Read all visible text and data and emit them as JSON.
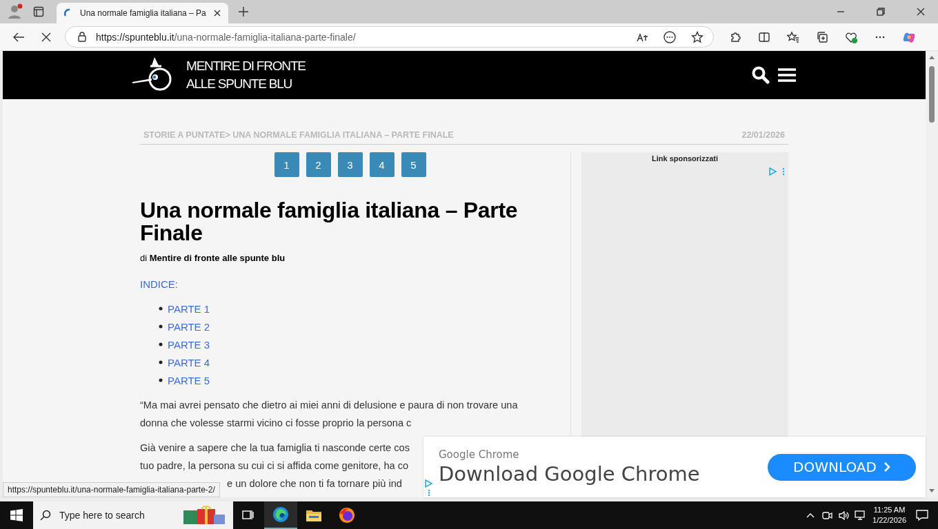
{
  "browser": {
    "tabs": [
      {
        "title": "Una normale famiglia italiana – Pa",
        "selected": true
      }
    ],
    "url_host": "https://spunteblu.it",
    "url_path": "/una-normale-famiglia-italiana-parte-finale/"
  },
  "site": {
    "logo_line1": "MENTIRE DI FRONTE",
    "logo_line2": "ALLE SPUNTE BLU"
  },
  "breadcrumb": "STORIE A PUNTATE> UNA NORMALE FAMIGLIA ITALIANA – PARTE FINALE",
  "date": "22/01/2026",
  "pages": [
    "1",
    "2",
    "3",
    "4",
    "5"
  ],
  "article": {
    "title": "Una normale famiglia italiana – Parte Finale",
    "byline": "di **Mentire di fronte alle spunte blu**",
    "index_label": "INDICE:",
    "index_items": [
      "PARTE 1",
      "PARTE 2",
      "PARTE 3",
      "PARTE 4",
      "PARTE 5"
    ],
    "paragraphs": [
      {
        "lines": [
          "“Ma mai avrei pensato che dietro ai miei anni di delusione e paura di non trovare una",
          "donna che volesse starmi vicino ci fosse proprio la persona c"
        ]
      },
      {
        "lines": [
          "Già venire a sapere che la tua famiglia ti nasconde certe cos",
          "tuo padre, la persona su cui ci si affida come genitore, ha co",
          "e un dolore che non ti fa tornare più ind"
        ]
      }
    ]
  },
  "sidebar_ad": {
    "label": "Link sponsorizzati"
  },
  "bottom_ad": {
    "advertiser": "Google Chrome",
    "headline": "Download Google Chrome",
    "button": "DOWNLOAD"
  },
  "status_url": "https://spunteblu.it/una-normale-famiglia-italiana-parte-2/",
  "taskbar": {
    "search_placeholder": "Type here to search",
    "time": "11:25 AM",
    "date": "1/22/2026"
  }
}
